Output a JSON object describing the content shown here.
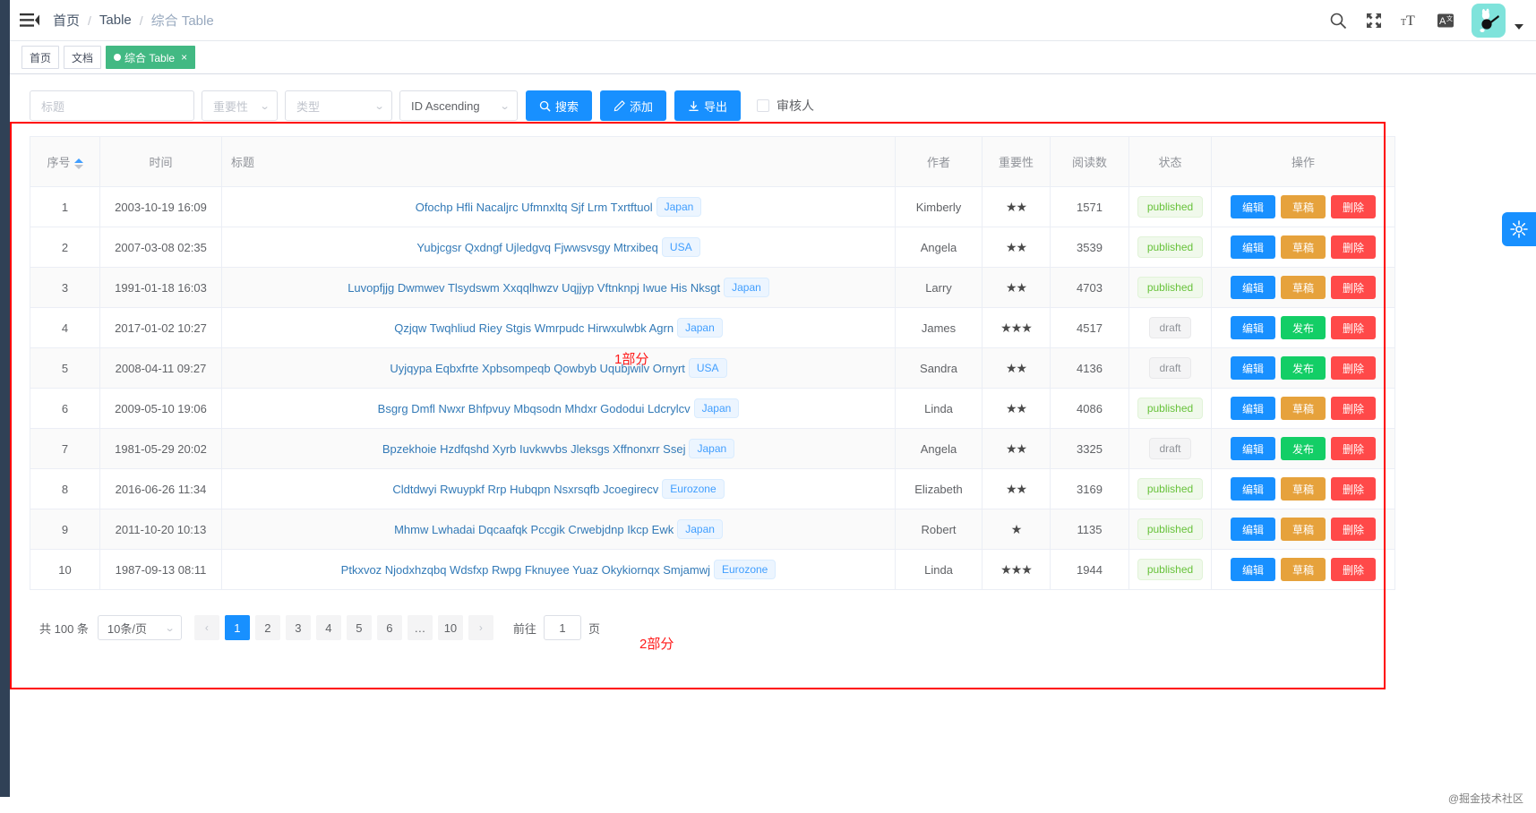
{
  "navbar": {
    "hamburger_icon": "hamburger-icon",
    "breadcrumb": [
      "首页",
      "Table",
      "综合 Table"
    ],
    "separator": "/",
    "icons": [
      "search-icon",
      "fullscreen-icon",
      "size-select-icon",
      "language-icon"
    ],
    "avatar_alt": "user-avatar"
  },
  "tags_view": {
    "tags": [
      {
        "label": "首页",
        "active": false,
        "closable": false
      },
      {
        "label": "文档",
        "active": false,
        "closable": false
      },
      {
        "label": "综合 Table",
        "active": true,
        "closable": true
      }
    ],
    "close_glyph": "×"
  },
  "filter": {
    "title_placeholder": "标题",
    "importance_label": "重要性",
    "type_label": "类型",
    "sort_label": "ID Ascending",
    "search_label": "搜索",
    "add_label": "添加",
    "export_label": "导出",
    "reviewer_label": "审核人",
    "reviewer_checked": false
  },
  "table": {
    "columns": [
      {
        "key": "id",
        "label": "序号",
        "sortable": true
      },
      {
        "key": "timestamp",
        "label": "时间",
        "sortable": false
      },
      {
        "key": "title",
        "label": "标题",
        "sortable": false
      },
      {
        "key": "author",
        "label": "作者",
        "sortable": false
      },
      {
        "key": "importance",
        "label": "重要性",
        "sortable": false
      },
      {
        "key": "pageviews",
        "label": "阅读数",
        "sortable": false
      },
      {
        "key": "status",
        "label": "状态",
        "sortable": false
      },
      {
        "key": "actions",
        "label": "操作",
        "sortable": false
      }
    ],
    "rows": [
      {
        "id": "1",
        "timestamp": "2003-10-19 16:09",
        "title": "Ofochp Hfli Nacaljrc Ufmnxltq Sjf Lrm Txrtftuol",
        "tag": "Japan",
        "author": "Kimberly",
        "importance": 2,
        "pageviews": "1571",
        "status": "published",
        "actions": [
          "编辑",
          "草稿",
          "删除"
        ]
      },
      {
        "id": "2",
        "timestamp": "2007-03-08 02:35",
        "title": "Yubjcgsr Qxdngf Ujledgvq Fjwwsvsgy Mtrxibeq",
        "tag": "USA",
        "author": "Angela",
        "importance": 2,
        "pageviews": "3539",
        "status": "published",
        "actions": [
          "编辑",
          "草稿",
          "删除"
        ]
      },
      {
        "id": "3",
        "timestamp": "1991-01-18 16:03",
        "title": "Luvopfjjg Dwmwev Tlsydswm Xxqqlhwzv Uqjjyp Vftnknpj Iwue His Nksgt",
        "tag": "Japan",
        "author": "Larry",
        "importance": 2,
        "pageviews": "4703",
        "status": "published",
        "actions": [
          "编辑",
          "草稿",
          "删除"
        ]
      },
      {
        "id": "4",
        "timestamp": "2017-01-02 10:27",
        "title": "Qzjqw Twqhliud Riey Stgis Wmrpudc Hirwxulwbk Agrn",
        "tag": "Japan",
        "author": "James",
        "importance": 3,
        "pageviews": "4517",
        "status": "draft",
        "actions": [
          "编辑",
          "发布",
          "删除"
        ]
      },
      {
        "id": "5",
        "timestamp": "2008-04-11 09:27",
        "title": "Uyjqypa Eqbxfrte Xpbsompeqb Qowbyb Uqubjwilv Ornyrt",
        "tag": "USA",
        "author": "Sandra",
        "importance": 2,
        "pageviews": "4136",
        "status": "draft",
        "actions": [
          "编辑",
          "发布",
          "删除"
        ]
      },
      {
        "id": "6",
        "timestamp": "2009-05-10 19:06",
        "title": "Bsgrg Dmfl Nwxr Bhfpvuy Mbqsodn Mhdxr Gododui Ldcrylcv",
        "tag": "Japan",
        "author": "Linda",
        "importance": 2,
        "pageviews": "4086",
        "status": "published",
        "actions": [
          "编辑",
          "草稿",
          "删除"
        ]
      },
      {
        "id": "7",
        "timestamp": "1981-05-29 20:02",
        "title": "Bpzekhoie Hzdfqshd Xyrb Iuvkwvbs Jleksgs Xffnonxrr Ssej",
        "tag": "Japan",
        "author": "Angela",
        "importance": 2,
        "pageviews": "3325",
        "status": "draft",
        "actions": [
          "编辑",
          "发布",
          "删除"
        ]
      },
      {
        "id": "8",
        "timestamp": "2016-06-26 11:34",
        "title": "Cldtdwyi Rwuypkf Rrp Hubqpn Nsxrsqfb Jcoegirecv",
        "tag": "Eurozone",
        "author": "Elizabeth",
        "importance": 2,
        "pageviews": "3169",
        "status": "published",
        "actions": [
          "编辑",
          "草稿",
          "删除"
        ]
      },
      {
        "id": "9",
        "timestamp": "2011-10-20 10:13",
        "title": "Mhmw Lwhadai Dqcaafqk Pccgik Crwebjdnp Ikcp Ewk",
        "tag": "Japan",
        "author": "Robert",
        "importance": 1,
        "pageviews": "1135",
        "status": "published",
        "actions": [
          "编辑",
          "草稿",
          "删除"
        ]
      },
      {
        "id": "10",
        "timestamp": "1987-09-13 08:11",
        "title": "Ptkxvoz Njodxhzqbq Wdsfxp Rwpg Fknuyee Yuaz Okykiornqx Smjamwj",
        "tag": "Eurozone",
        "author": "Linda",
        "importance": 3,
        "pageviews": "1944",
        "status": "published",
        "actions": [
          "编辑",
          "草稿",
          "删除"
        ]
      }
    ]
  },
  "pagination": {
    "total_label": "共 100 条",
    "page_size_label": "10条/页",
    "prev_glyph": "‹",
    "next_glyph": "›",
    "pages": [
      "1",
      "2",
      "3",
      "4",
      "5",
      "6",
      "…",
      "10"
    ],
    "current_page": "1",
    "jump_prefix": "前往",
    "jump_value": "1",
    "jump_suffix": "页"
  },
  "annotations": [
    {
      "text": "1部分",
      "color": "#ff1a1a"
    },
    {
      "text": "2部分",
      "color": "#ff1a1a"
    }
  ],
  "watermark": "@掘金技术社区",
  "colors": {
    "primary": "#1890ff",
    "success": "#13ce66",
    "danger": "#ff4949",
    "tag_active": "#42b983",
    "link": "#337ab7",
    "annotation": "#ff0000"
  }
}
